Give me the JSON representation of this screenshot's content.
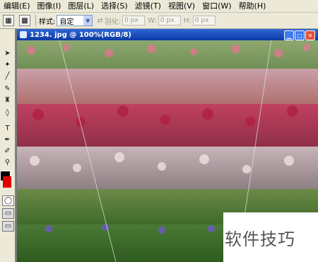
{
  "menubar": {
    "items": [
      "编辑(E)",
      "图像(I)",
      "图层(L)",
      "选择(S)",
      "滤镜(T)",
      "视图(V)",
      "窗口(W)",
      "帮助(H)"
    ]
  },
  "options": {
    "style_label": "样式:",
    "style_value": "自定",
    "feather_label": "羽化:",
    "feather_value": "0 px",
    "w_label": "W:",
    "w_value": "0 px",
    "h_label": "H:",
    "h_value": "0 px"
  },
  "document": {
    "title": "1234. jpg @ 100%(RGB/8)"
  },
  "watermark": {
    "text": "软件技巧"
  },
  "colors": {
    "titlebar": "#0a3aa3",
    "foreground": "#000000",
    "background": "#e00000"
  }
}
